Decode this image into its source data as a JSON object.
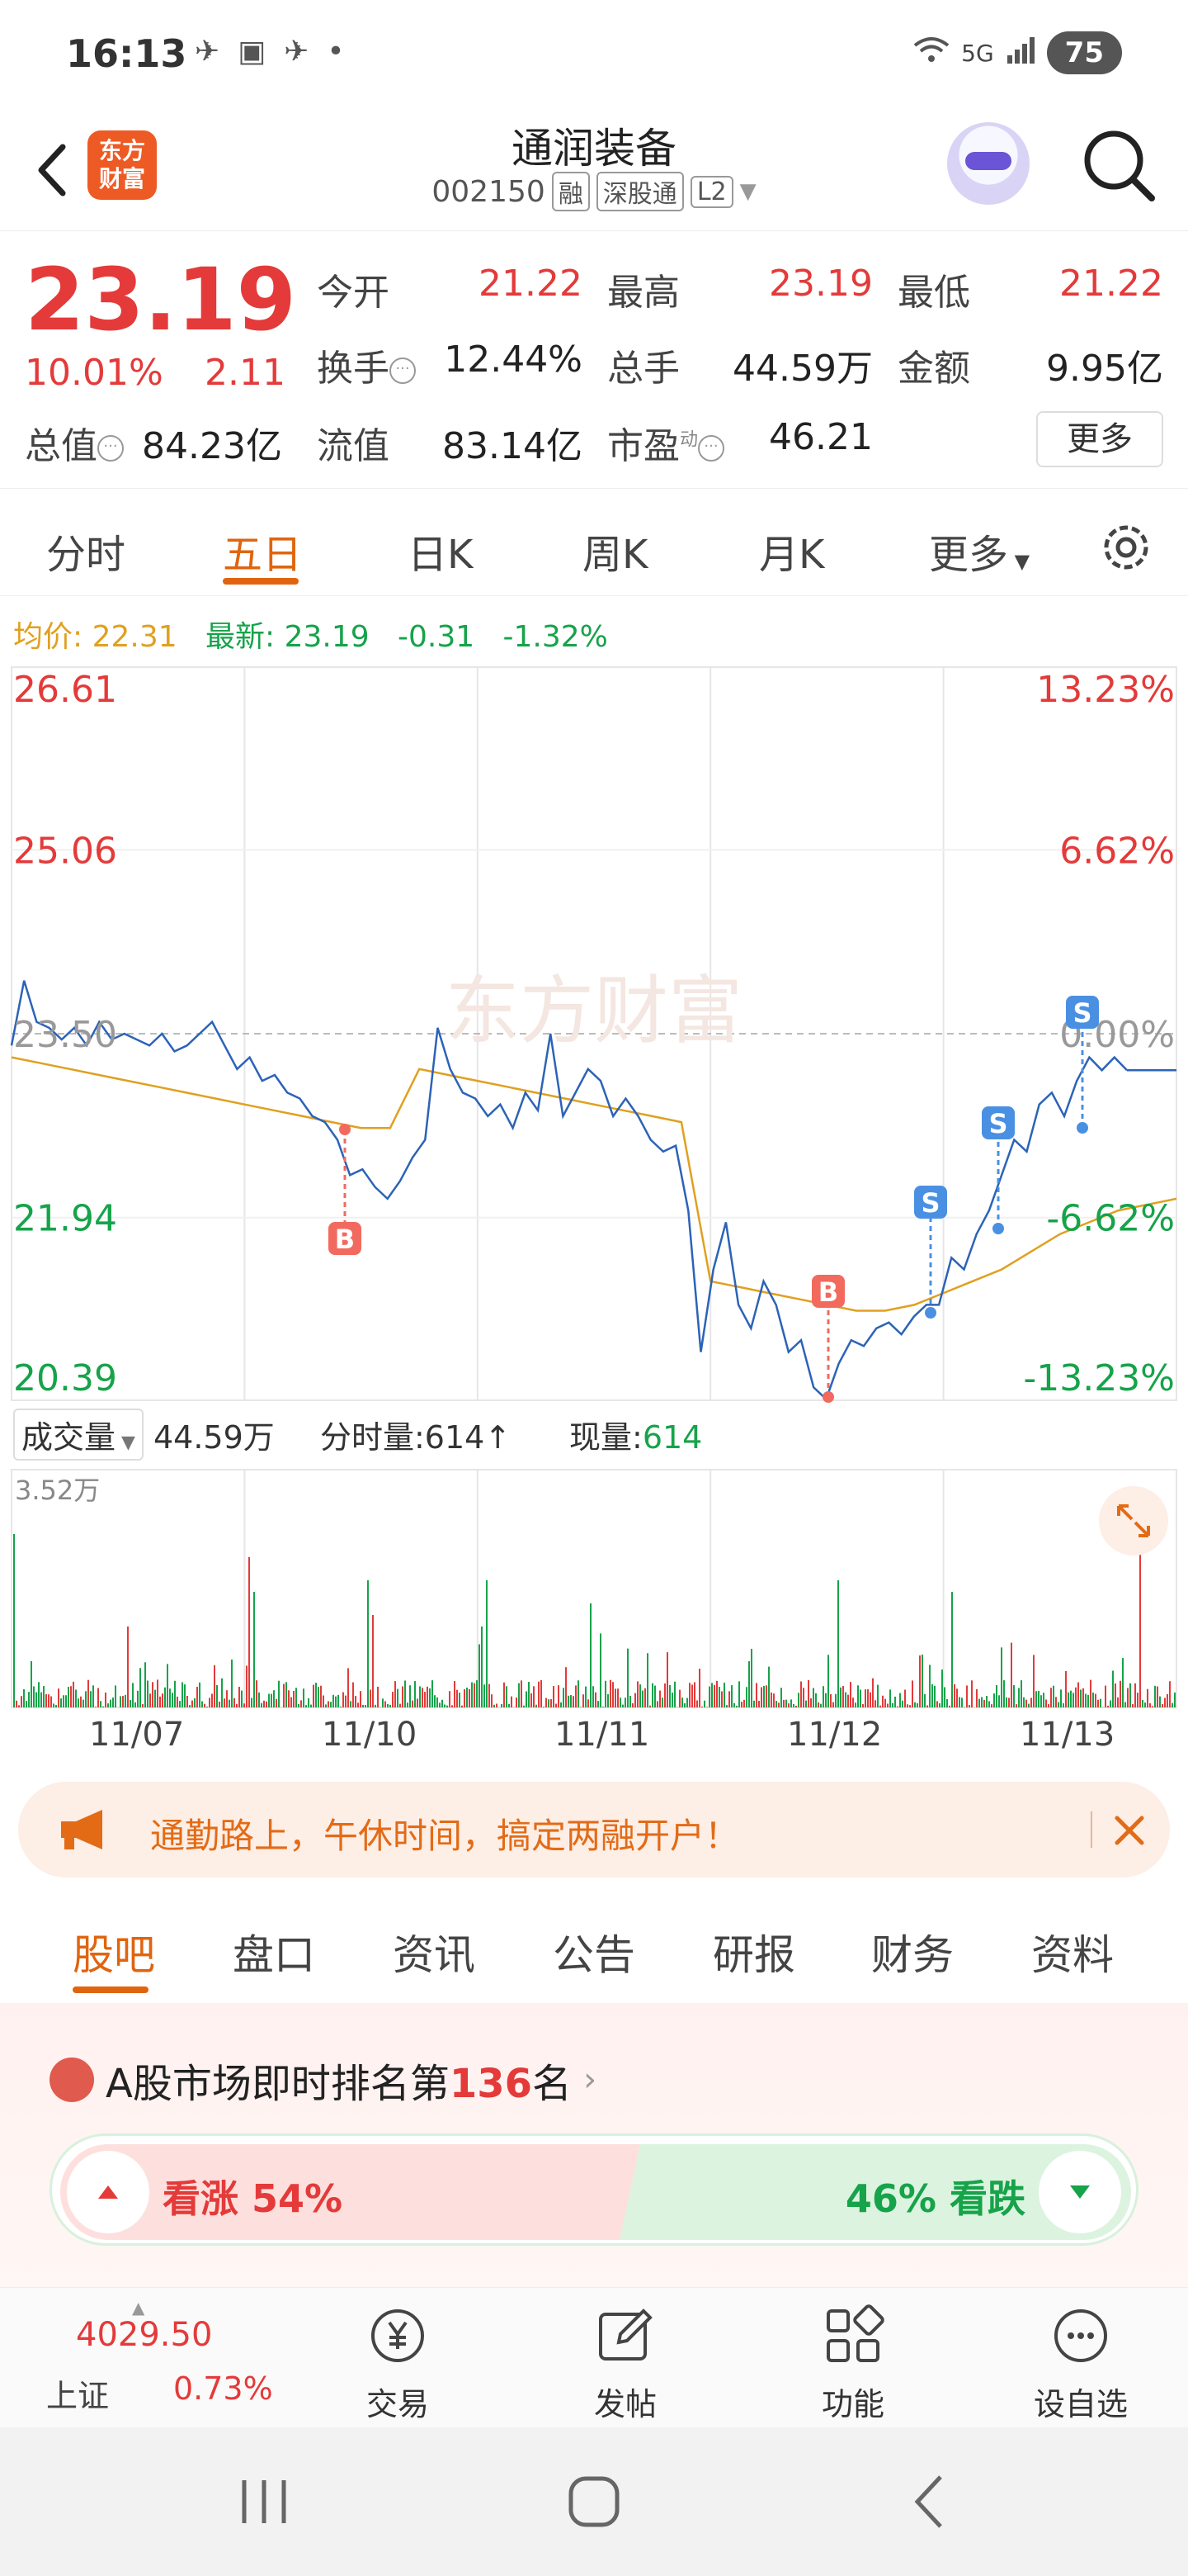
{
  "status_bar": {
    "time": "16:13",
    "battery": "75",
    "signal_label": "5G"
  },
  "header": {
    "logo_text_1": "东方",
    "logo_text_2": "财富",
    "stock_name": "通润装备",
    "stock_code": "002150",
    "tags": [
      "融",
      "深股通",
      "L2"
    ]
  },
  "quote": {
    "price": "23.19",
    "change_pct": "10.01%",
    "change_val": "2.11",
    "open_label": "今开",
    "open": "21.22",
    "high_label": "最高",
    "high": "23.19",
    "low_label": "最低",
    "low": "21.22",
    "turnover_label": "换手",
    "turnover": "12.44%",
    "volume_label": "总手",
    "volume": "44.59万",
    "amount_label": "金额",
    "amount": "9.95亿",
    "mktcap_label": "总值",
    "mktcap": "84.23亿",
    "float_label": "流值",
    "float": "83.14亿",
    "pe_label": "市盈",
    "pe_superscript": "动",
    "pe": "46.21",
    "more_label": "更多"
  },
  "chart_tabs": {
    "items": [
      "分时",
      "五日",
      "日K",
      "周K",
      "月K",
      "更多"
    ],
    "active": "五日"
  },
  "avg_line": {
    "avg_label": "均价:",
    "avg_value": "22.31",
    "latest_label": "最新:",
    "latest_value": "23.19",
    "latest_change": "-0.31",
    "latest_pct": "-1.32%"
  },
  "chart_data": {
    "type": "line",
    "ylim": [
      20.39,
      26.61
    ],
    "y_ticks_left": [
      "26.61",
      "25.06",
      "23.50",
      "21.94",
      "20.39"
    ],
    "y_ticks_right": [
      "13.23%",
      "6.62%",
      "0.00%",
      "-6.62%",
      "-13.23%"
    ],
    "x_categories": [
      "11/07",
      "11/10",
      "11/11",
      "11/12",
      "11/13"
    ],
    "watermark": "东方财富",
    "series": [
      {
        "values": [
          23.4,
          23.95,
          23.6,
          23.55,
          23.45,
          23.55,
          23.4,
          23.6,
          23.45,
          23.5,
          23.45,
          23.4,
          23.5,
          23.35,
          23.4,
          23.5,
          23.6,
          23.4,
          23.2,
          23.3,
          23.1,
          23.15,
          23.0,
          22.95,
          22.8,
          22.75,
          22.6,
          22.3,
          22.35,
          22.2,
          22.1,
          22.25,
          22.45,
          22.6,
          23.55,
          23.2,
          23.0,
          22.95,
          22.8,
          22.9,
          22.7,
          23.0,
          22.85,
          23.5,
          22.8,
          23.0,
          23.2,
          23.1,
          22.8,
          22.95,
          22.8,
          22.6,
          22.5,
          22.55,
          22.0,
          20.8,
          21.5,
          21.9,
          21.2,
          21.0,
          21.4,
          21.2,
          20.8,
          20.9,
          20.5,
          20.4,
          20.7,
          20.9,
          20.85,
          21.0,
          21.05,
          20.95,
          21.1,
          21.2,
          21.2,
          21.6,
          21.5,
          21.8,
          22.0,
          22.3,
          22.6,
          22.5,
          22.9,
          23.0,
          22.8,
          23.1,
          23.3,
          23.19,
          23.3,
          23.19
        ]
      },
      {
        "values": [
          23.3,
          23.25,
          23.2,
          23.15,
          23.1,
          23.05,
          23.0,
          22.95,
          22.9,
          22.85,
          22.8,
          22.75,
          22.7,
          22.7,
          23.2,
          23.15,
          23.1,
          23.05,
          23.0,
          22.95,
          22.9,
          22.85,
          22.8,
          22.75,
          21.4,
          21.35,
          21.3,
          21.25,
          21.2,
          21.15,
          21.15,
          21.2,
          21.3,
          21.4,
          21.5,
          21.65,
          21.8,
          21.9,
          22.0,
          22.05,
          22.1
        ]
      }
    ],
    "markers": [
      {
        "label": "B",
        "day": "11/10"
      },
      {
        "label": "B",
        "day": "11/12"
      },
      {
        "label": "S",
        "day": "11/12"
      },
      {
        "label": "S",
        "day": "11/13"
      },
      {
        "label": "S",
        "day": "11/13"
      }
    ]
  },
  "volume_row": {
    "select_label": "成交量",
    "total": "44.59万",
    "tick_label": "分时量:614↑",
    "now_label": "现量:",
    "now_value": "614",
    "max_label": "3.52万"
  },
  "banner": {
    "text": "通勤路上，午休时间，搞定两融开户！"
  },
  "info_tabs": {
    "items": [
      "股吧",
      "盘口",
      "资讯",
      "公告",
      "研报",
      "财务",
      "资料"
    ],
    "active": "股吧"
  },
  "rank": {
    "prefix": "A股市场即时排名第",
    "number": "136",
    "suffix": "名",
    "bull_text": "看涨 54%",
    "bear_text": "46% 看跌",
    "bull_pct": 54,
    "bear_pct": 46
  },
  "bottom_nav": {
    "index_value": "4029.50",
    "index_name": "上证",
    "index_pct": "0.73%",
    "items": [
      "交易",
      "发帖",
      "功能",
      "设自选"
    ]
  },
  "colors": {
    "up": "#e43a3a",
    "down": "#16a34a",
    "accent": "#e0640f",
    "avg": "#e0a020",
    "line": "#2c63b7"
  }
}
